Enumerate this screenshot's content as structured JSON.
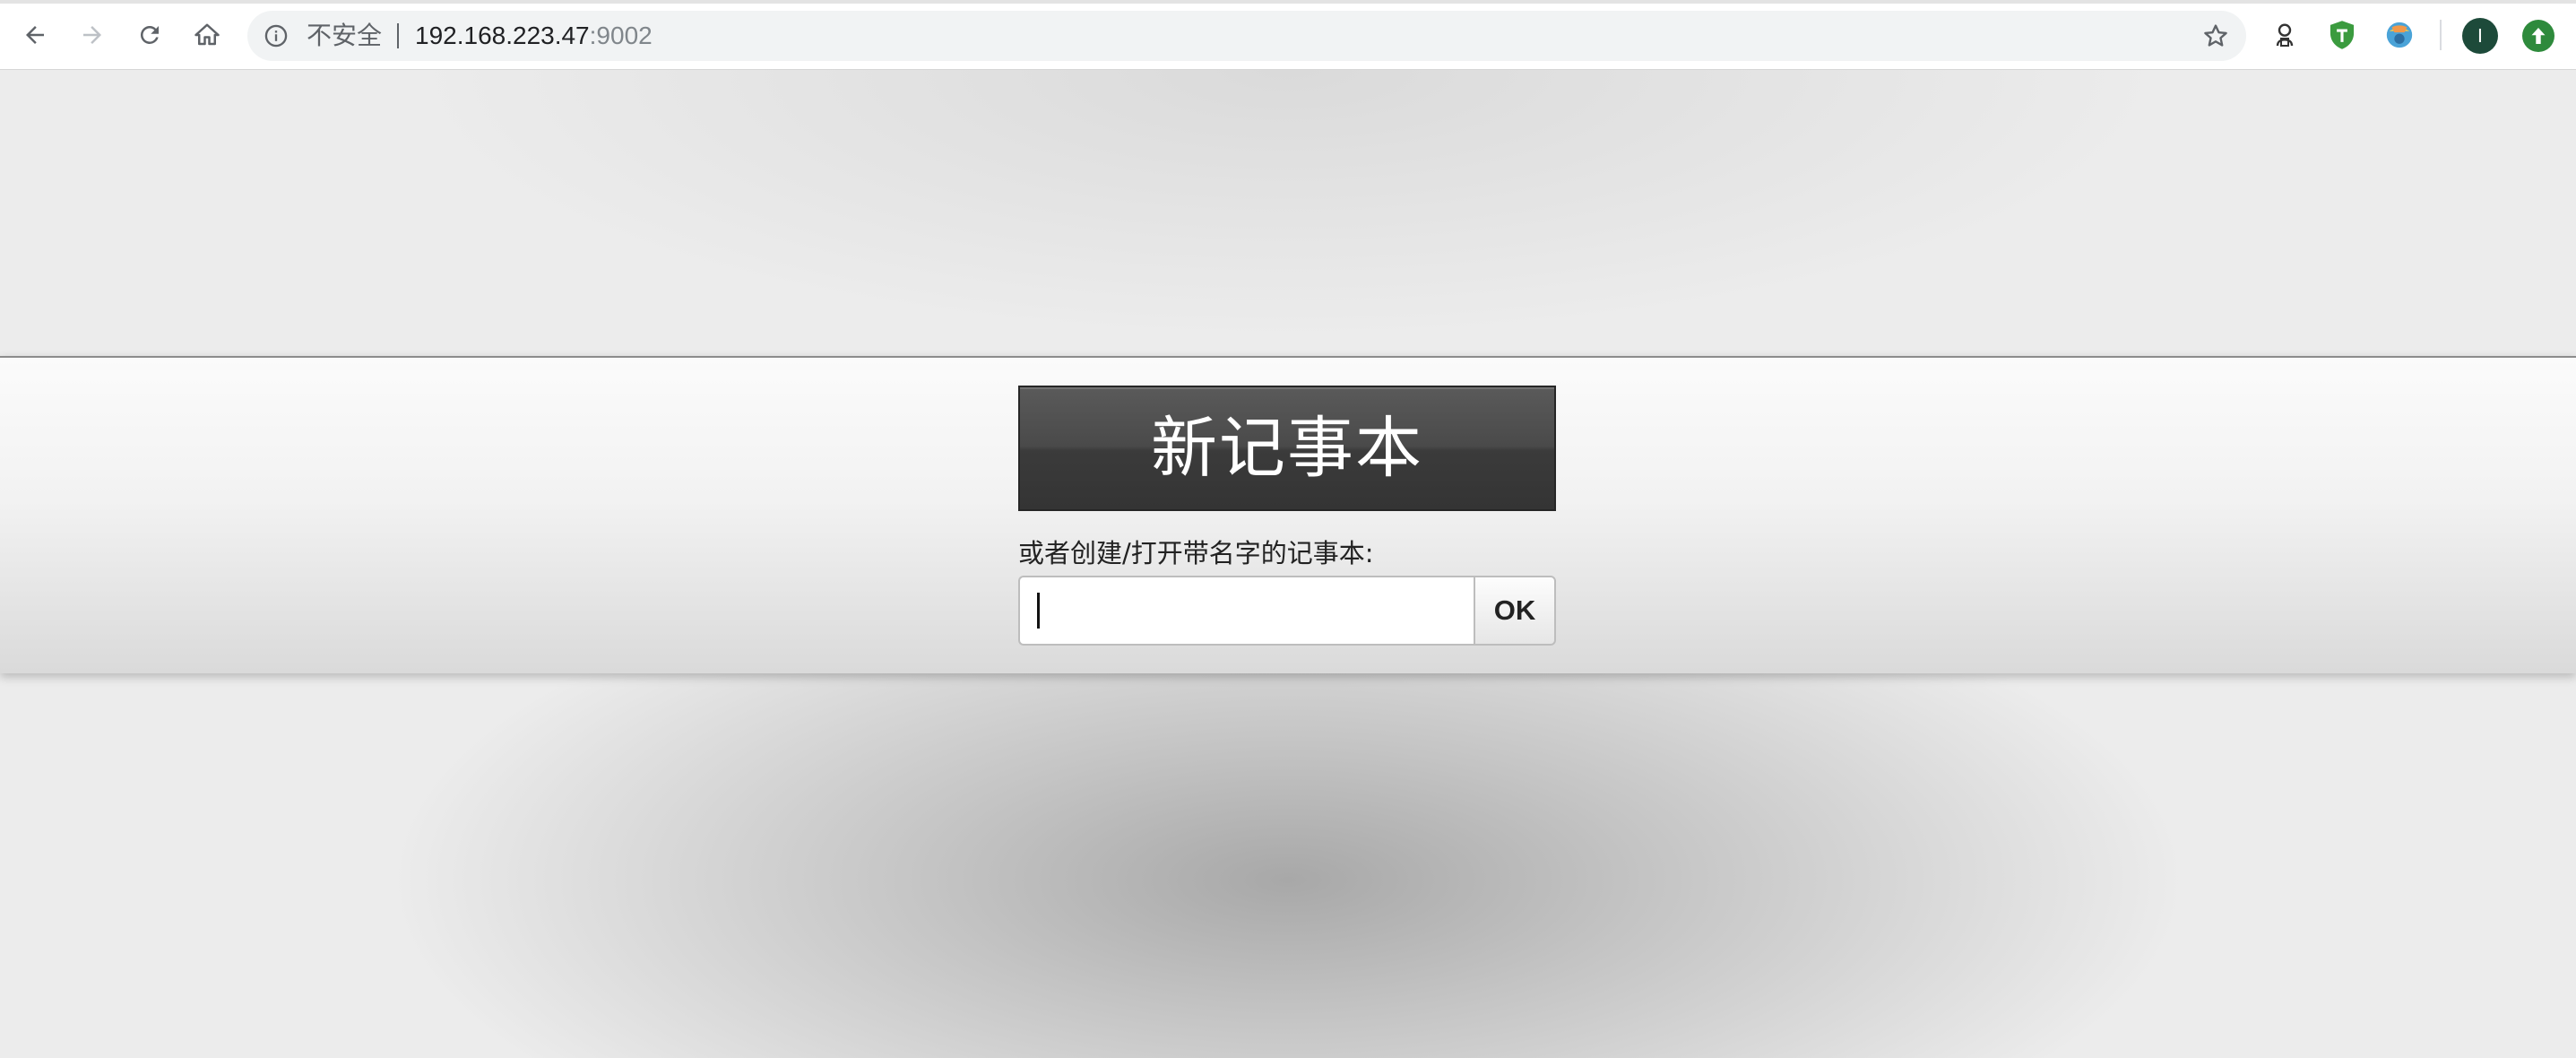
{
  "browser": {
    "security_label": "不安全",
    "url_host": "192.168.223.47",
    "url_port": ":9002",
    "avatar_initial": "I",
    "icons": {
      "back": "back-arrow-icon",
      "forward": "forward-arrow-icon",
      "reload": "reload-icon",
      "home": "home-icon",
      "info": "info-icon",
      "bookmark": "star-icon",
      "extensions": [
        "extension-outline-icon",
        "tampermonkey-shield-icon",
        "extension-globe-icon"
      ],
      "update": "update-arrow-icon"
    }
  },
  "page": {
    "new_note_label": "新记事本",
    "prompt_label": "或者创建/打开带名字的记事本:",
    "name_input_value": "",
    "ok_label": "OK"
  },
  "colors": {
    "button_dark": "#404040",
    "shield_green": "#3b9b3f",
    "avatar_bg": "#1d4a3a"
  }
}
